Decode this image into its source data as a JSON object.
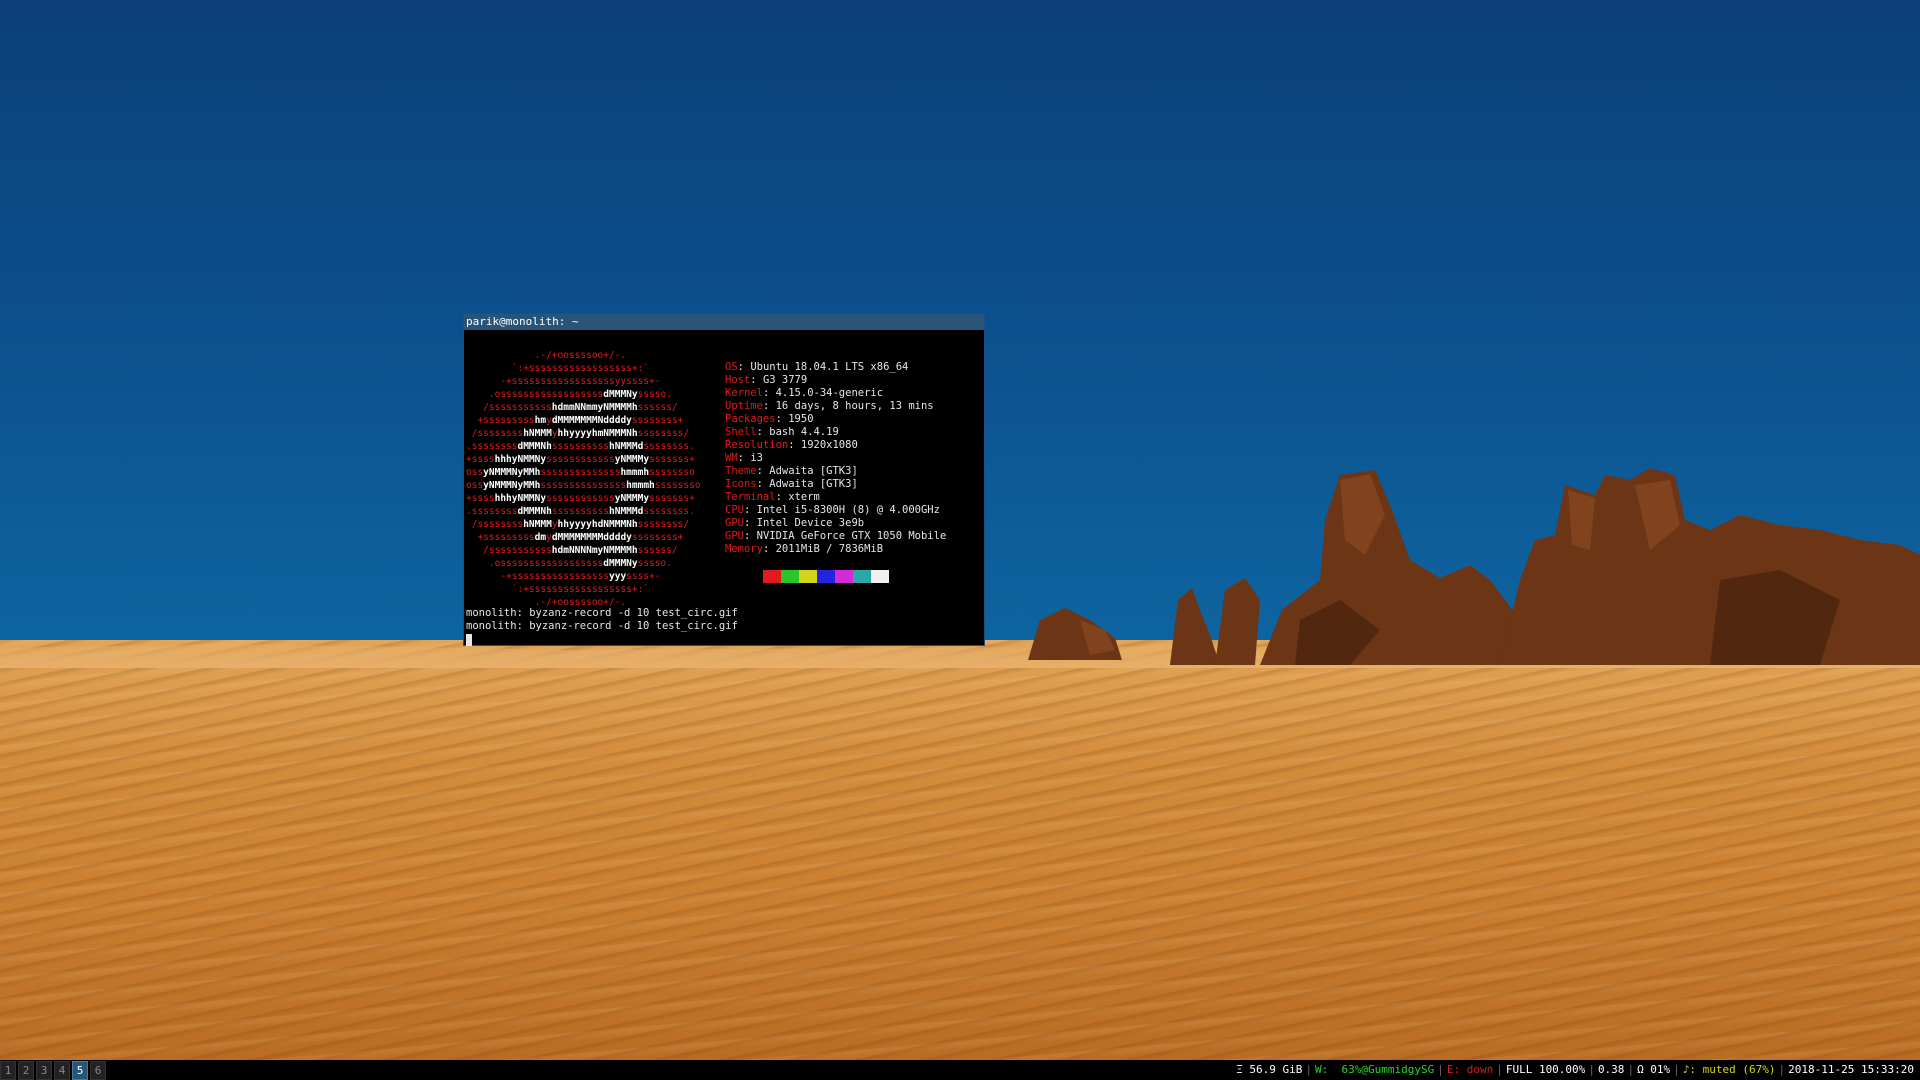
{
  "terminal": {
    "title": "parik@monolith: ~",
    "info": [
      {
        "key": "OS",
        "value": "Ubuntu 18.04.1 LTS x86_64"
      },
      {
        "key": "Host",
        "value": "G3 3779"
      },
      {
        "key": "Kernel",
        "value": "4.15.0-34-generic"
      },
      {
        "key": "Uptime",
        "value": "16 days, 8 hours, 13 mins"
      },
      {
        "key": "Packages",
        "value": "1950"
      },
      {
        "key": "Shell",
        "value": "bash 4.4.19"
      },
      {
        "key": "Resolution",
        "value": "1920x1080"
      },
      {
        "key": "WM",
        "value": "i3"
      },
      {
        "key": "Theme",
        "value": "Adwaita [GTK3]"
      },
      {
        "key": "Icons",
        "value": "Adwaita [GTK3]"
      },
      {
        "key": "Terminal",
        "value": "xterm"
      },
      {
        "key": "CPU",
        "value": "Intel i5-8300H (8) @ 4.000GHz"
      },
      {
        "key": "GPU",
        "value": "Intel Device 3e9b"
      },
      {
        "key": "GPU",
        "value": "NVIDIA GeForce GTX 1050 Mobile"
      },
      {
        "key": "Memory",
        "value": "2011MiB / 7836MiB"
      }
    ],
    "palette": [
      "#000000",
      "#e01b1b",
      "#2bc42b",
      "#d4d41d",
      "#2424e0",
      "#d42bd4",
      "#2aa8a8",
      "#f0f0f0"
    ],
    "commands": [
      "monolith: byzanz-record -d 10 test_circ.gif",
      "monolith: byzanz-record -d 10 test_circ.gif"
    ]
  },
  "bar": {
    "workspaces": [
      "1",
      "2",
      "3",
      "4",
      "5",
      "6"
    ],
    "focused_workspace": "5",
    "status": [
      {
        "text": "Ξ 56.9 GiB",
        "color": "#ffffff"
      },
      {
        "text": "W:  63%@GummidgySG",
        "color": "#2bd42b"
      },
      {
        "text": "E: down",
        "color": "#e01b1b"
      },
      {
        "text": "FULL 100.00%",
        "color": "#ffffff"
      },
      {
        "text": "0.38",
        "color": "#ffffff"
      },
      {
        "text": "Ω 01%",
        "color": "#ffffff"
      },
      {
        "text": "♪: muted (67%)",
        "color": "#d4d41d"
      },
      {
        "text": "2018-11-25 15:33:20",
        "color": "#ffffff"
      }
    ]
  }
}
